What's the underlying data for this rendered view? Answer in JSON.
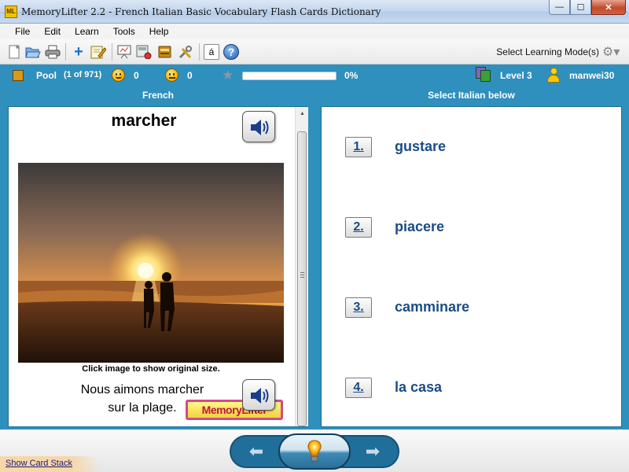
{
  "window": {
    "app_badge": "ML",
    "title": "MemoryLifter 2.2 - French Italian Basic Vocabulary Flash Cards Dictionary",
    "minimize_glyph": "—",
    "maximize_glyph": "☐",
    "close_glyph": "✕"
  },
  "menu": [
    "File",
    "Edit",
    "Learn",
    "Tools",
    "Help"
  ],
  "toolbar": {
    "icons": [
      "new-icon",
      "open-icon",
      "print-icon",
      "add-icon",
      "edit-icon",
      "presentation-icon",
      "card-style-icon",
      "dictionary-icon",
      "tools-icon",
      "special-char-icon",
      "help-icon"
    ],
    "special_char_glyph": "á",
    "help_glyph": "?",
    "add_glyph": "+",
    "learning_mode_label": "Select Learning Mode(s)",
    "mode_glyph": "⚙▾"
  },
  "status": {
    "pool_label": "Pool",
    "pool_count": "(1 of 971)",
    "correct_count": "0",
    "wrong_count": "0",
    "star_glyph": "★",
    "progress_percent": 0,
    "progress_text": "0%",
    "level": "Level 3",
    "user": "manwei30",
    "colors": {
      "bar": "#2f8fbd",
      "progress_fill": "#2ea44f"
    }
  },
  "question": {
    "header": "French",
    "word": "marcher",
    "image_caption": "Click image to show original size.",
    "example_line1": "Nous aimons marcher",
    "example_line2": "sur la plage.",
    "logo_text": "MemoryLifter",
    "scroll_up": "▲",
    "scroll_down": "▼"
  },
  "answers": {
    "header": "Select Italian below",
    "options": [
      {
        "number": "1.",
        "text": "gustare"
      },
      {
        "number": "2.",
        "text": "piacere"
      },
      {
        "number": "3.",
        "text": "camminare"
      },
      {
        "number": "4.",
        "text": "la casa"
      }
    ]
  },
  "bottom": {
    "prev_glyph": "⬅",
    "next_glyph": "➡",
    "show_card_stack": "Show Card Stack"
  }
}
